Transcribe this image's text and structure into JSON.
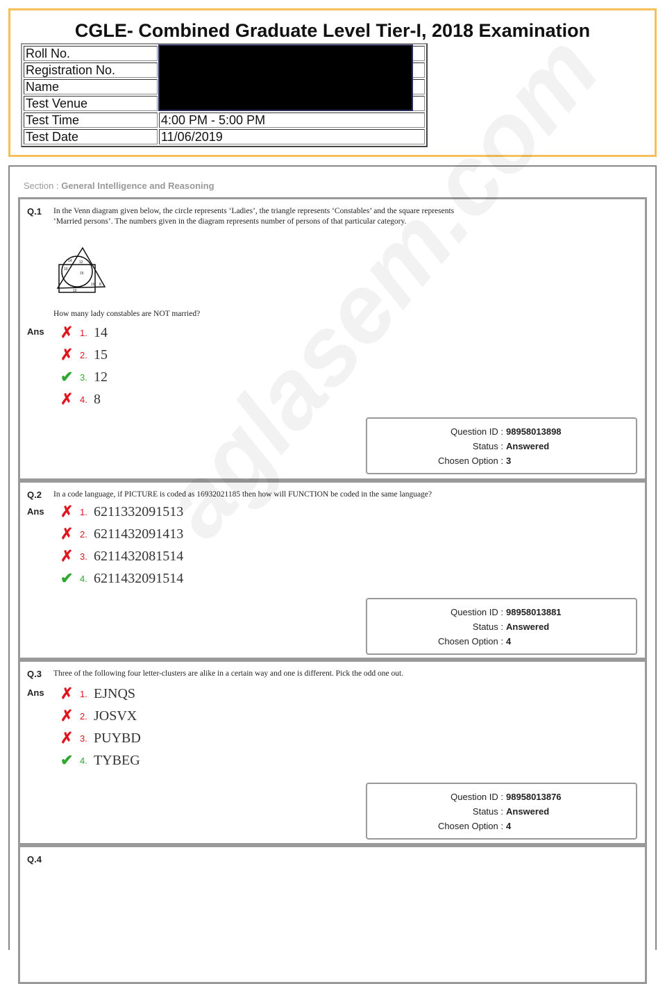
{
  "header": {
    "title": "CGLE- Combined Graduate Level Tier-I, 2018 Examination",
    "rows": [
      {
        "label": "Roll No.",
        "value": ""
      },
      {
        "label": "Registration No.",
        "value": ""
      },
      {
        "label": "Name",
        "value": ""
      },
      {
        "label": "Test Venue",
        "value": ""
      },
      {
        "label": "Test Time",
        "value": "4:00 PM - 5:00 PM"
      },
      {
        "label": "Test Date",
        "value": "11/06/2019"
      }
    ]
  },
  "section": {
    "prefix": "Section : ",
    "name": "General Intelligence and Reasoning"
  },
  "labels": {
    "ans": "Ans",
    "qid": "Question ID :",
    "status": "Status :",
    "chosen": "Chosen Option :"
  },
  "questions": [
    {
      "num": "Q.1",
      "text": "In the Venn diagram given below, the circle represents ‘Ladies’, the triangle represents ‘Constables’ and the square represents ‘Married persons’. The numbers given in the diagram represents number of persons of that particular category.",
      "text2": "How many lady constables are NOT married?",
      "venn": [
        "14",
        "12",
        "10",
        "15",
        "16",
        "8",
        "10"
      ],
      "options": [
        {
          "n": "1.",
          "v": "14",
          "correct": false
        },
        {
          "n": "2.",
          "v": "15",
          "correct": false
        },
        {
          "n": "3.",
          "v": "12",
          "correct": true
        },
        {
          "n": "4.",
          "v": "8",
          "correct": false
        }
      ],
      "id": "98958013898",
      "status": "Answered",
      "chosen": "3"
    },
    {
      "num": "Q.2",
      "text": "In a code language, if PICTURE is coded as 16932021185 then how will FUNCTION be coded in the same language?",
      "options": [
        {
          "n": "1.",
          "v": "6211332091513",
          "correct": false
        },
        {
          "n": "2.",
          "v": "6211432091413",
          "correct": false
        },
        {
          "n": "3.",
          "v": "6211432081514",
          "correct": false
        },
        {
          "n": "4.",
          "v": "6211432091514",
          "correct": true
        }
      ],
      "id": "98958013881",
      "status": "Answered",
      "chosen": "4"
    },
    {
      "num": "Q.3",
      "text": "Three of the following four letter-clusters are alike in a certain way and one is different. Pick the odd one out.",
      "options": [
        {
          "n": "1.",
          "v": "EJNQS",
          "correct": false
        },
        {
          "n": "2.",
          "v": "JOSVX",
          "correct": false
        },
        {
          "n": "3.",
          "v": "PUYBD",
          "correct": false
        },
        {
          "n": "4.",
          "v": "TYBEG",
          "correct": true
        }
      ],
      "id": "98958013876",
      "status": "Answered",
      "chosen": "4"
    },
    {
      "num": "Q.4"
    }
  ],
  "watermark": "aglasem.com",
  "colors": {
    "header_border": "#f5c05a",
    "wrong": "#e0141e",
    "correct": "#2fa82f"
  }
}
